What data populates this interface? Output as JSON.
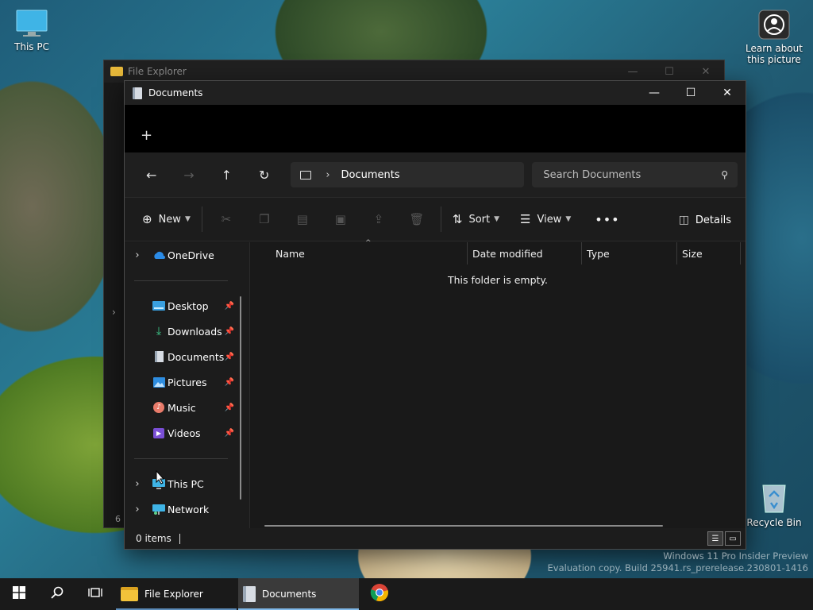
{
  "desktop": {
    "icons": {
      "this_pc": "This PC",
      "learn": "Learn about this picture",
      "recycle": "Recycle Bin"
    },
    "watermark_line1": "Windows 11 Pro Insider Preview",
    "watermark_line2": "Evaluation copy. Build 25941.rs_prerelease.230801-1416"
  },
  "back_window": {
    "title": "File Explorer",
    "status": "6 i"
  },
  "window": {
    "title": "Documents",
    "new_tab_icon": "plus-icon",
    "address": {
      "root_icon": "monitor-icon",
      "crumb": "Documents"
    },
    "search_placeholder": "Search Documents",
    "commands": {
      "new_label": "New",
      "sort_label": "Sort",
      "view_label": "View",
      "details_label": "Details"
    },
    "nav_items": {
      "onedrive": "OneDrive",
      "desktop": "Desktop",
      "downloads": "Downloads",
      "documents": "Documents",
      "pictures": "Pictures",
      "music": "Music",
      "videos": "Videos",
      "this_pc": "This PC",
      "network": "Network"
    },
    "columns": {
      "name": "Name",
      "date_modified": "Date modified",
      "type": "Type",
      "size": "Size"
    },
    "empty_message": "This folder is empty.",
    "status": "0 items"
  },
  "taskbar": {
    "apps": {
      "file_explorer": "File Explorer",
      "documents": "Documents"
    }
  },
  "colors": {
    "accent": "#7fb8e8",
    "window_bg": "#191919",
    "taskbar_bg": "#1a1a1a"
  }
}
